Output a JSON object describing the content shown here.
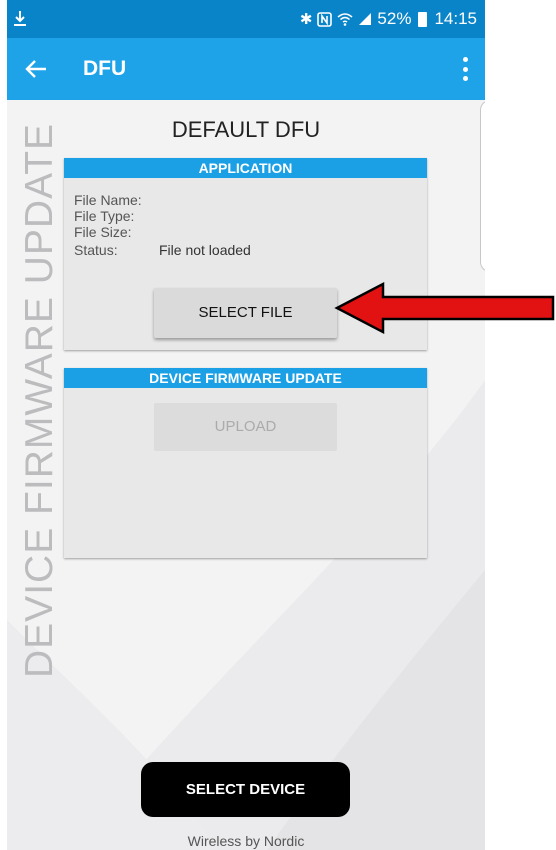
{
  "status_bar": {
    "icons": [
      "download-icon",
      "bluetooth-icon",
      "nfc-icon",
      "wifi-icon",
      "signal-icon",
      "battery-icon"
    ],
    "battery": "52%",
    "time": "14:15"
  },
  "app_bar": {
    "title": "DFU",
    "icons": [
      "back-arrow-icon",
      "more-vert-icon"
    ]
  },
  "side_title": "DEVICE FIRMWARE UPDATE",
  "page_title": "DEFAULT DFU",
  "application_panel": {
    "header": "APPLICATION",
    "file_name_label": "File Name:",
    "file_type_label": "File Type:",
    "file_size_label": "File Size:",
    "status_label": "Status:",
    "status_value": "File not loaded",
    "select_file_button": "SELECT FILE"
  },
  "dfu_panel": {
    "header": "DEVICE FIRMWARE UPDATE",
    "upload_button": "UPLOAD"
  },
  "select_device_button": "SELECT DEVICE",
  "footer": "Wireless by Nordic",
  "colors": {
    "status_bar": "#0a84c8",
    "app_bar": "#1fa3e8",
    "panel_header": "#1ba0e6",
    "arrow_annotation": "#e31212"
  }
}
